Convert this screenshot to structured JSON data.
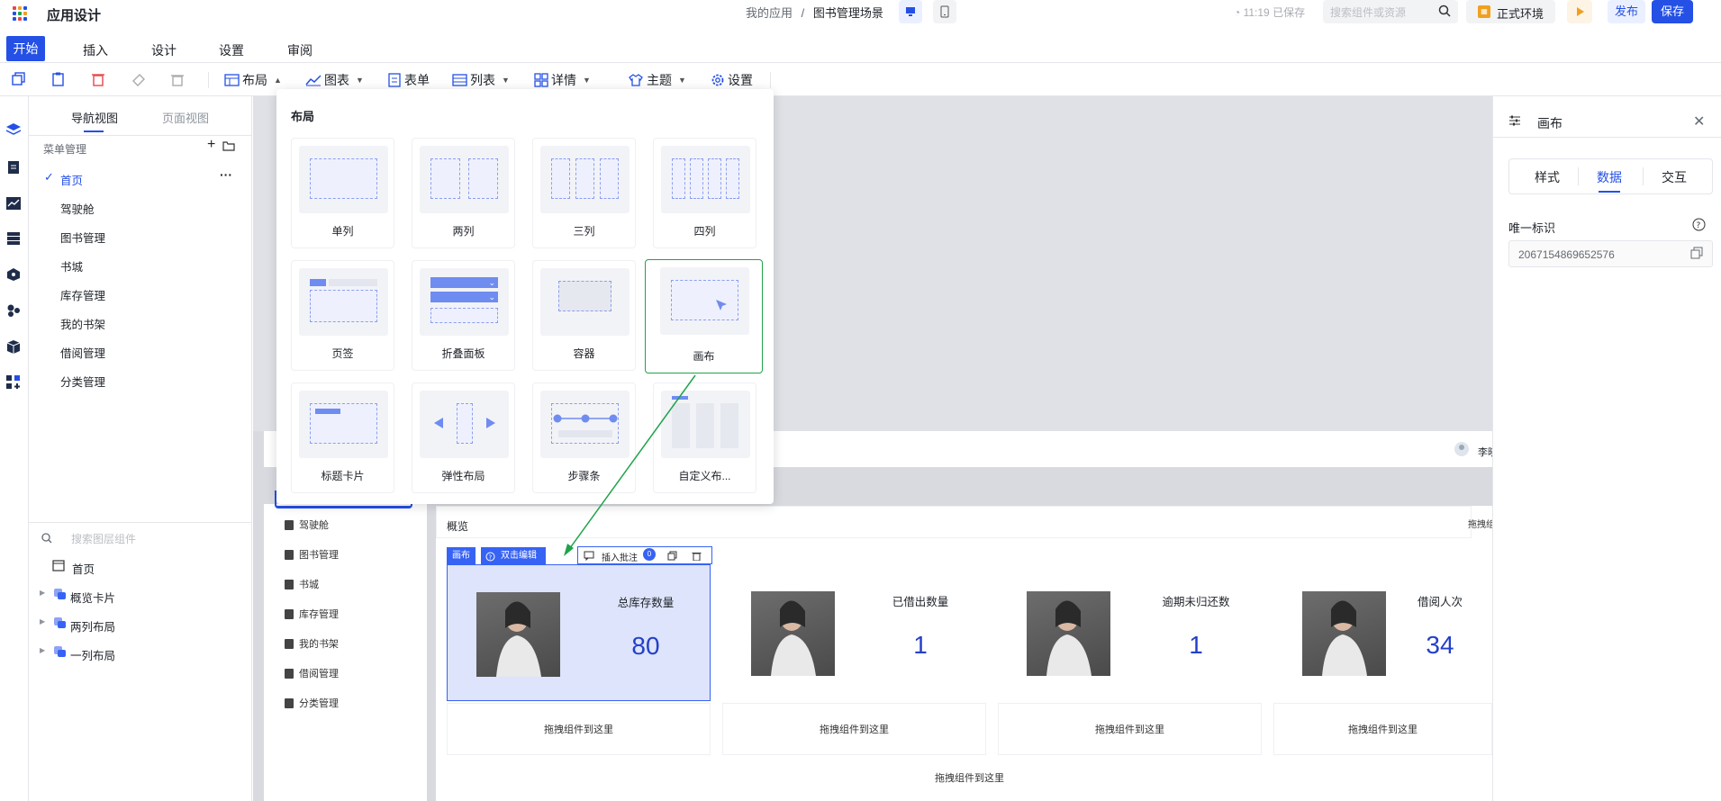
{
  "header": {
    "app_title": "应用设计",
    "breadcrumb_root": "我的应用",
    "breadcrumb_sep": "/",
    "breadcrumb_current": "图书管理场景",
    "saved_status": "11:19 已保存",
    "search_placeholder": "搜索组件或资源",
    "env_label": "正式环境",
    "publish_label": "发布",
    "save_label": "保存"
  },
  "menu_tabs": [
    "开始",
    "插入",
    "设计",
    "设置",
    "审阅"
  ],
  "toolbar": {
    "layout": "布局",
    "chart": "图表",
    "form": "表单",
    "list": "列表",
    "detail": "详情",
    "theme": "主题",
    "settings": "设置"
  },
  "nav_panel": {
    "tab_nav": "导航视图",
    "tab_page": "页面视图",
    "menu_mgmt": "菜单管理",
    "items": [
      "首页",
      "驾驶舱",
      "图书管理",
      "书城",
      "库存管理",
      "我的书架",
      "借阅管理",
      "分类管理"
    ],
    "layer_search_placeholder": "搜索图层组件",
    "tree": [
      "首页",
      "概览卡片",
      "两列布局",
      "一列布局"
    ]
  },
  "canvas": {
    "left_nav": [
      "驾驶舱",
      "图书管理",
      "书城",
      "库存管理",
      "我的书架",
      "借阅管理",
      "分类管理"
    ],
    "user_name": "李晓",
    "overview_title": "概览",
    "drag_top": "拖拽组",
    "widget_tag": "画布",
    "widget_edit": "双击编辑",
    "insert_annotation": "插入批注",
    "annotation_count": "0",
    "cards": [
      {
        "label": "总库存数量",
        "value": "80"
      },
      {
        "label": "已借出数量",
        "value": "1"
      },
      {
        "label": "逾期未归还数",
        "value": "1"
      },
      {
        "label": "借阅人次",
        "value": "34"
      }
    ],
    "drop_label": "拖拽组件到这里"
  },
  "layout_popup": {
    "title": "布局",
    "items": [
      "单列",
      "两列",
      "三列",
      "四列",
      "页签",
      "折叠面板",
      "容器",
      "画布",
      "标题卡片",
      "弹性布局",
      "步骤条",
      "自定义布..."
    ]
  },
  "right_panel": {
    "title": "画布",
    "tabs": [
      "样式",
      "数据",
      "交互"
    ],
    "id_label": "唯一标识",
    "id_value": "2067154869652576"
  },
  "colors": {
    "accent": "#2450e6",
    "highlight": "#1fa34a"
  }
}
